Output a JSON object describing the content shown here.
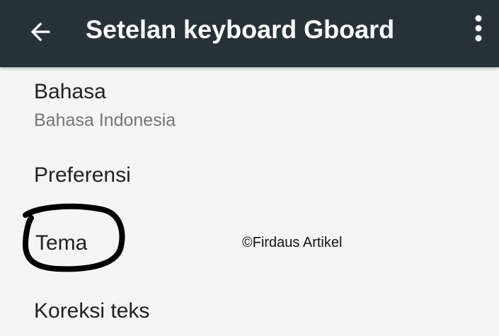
{
  "app_bar": {
    "title": "Setelan keyboard Gboard",
    "background": "#263238",
    "back_icon": "arrow-back-icon",
    "overflow_icon": "more-vert-icon"
  },
  "settings": {
    "items": [
      {
        "title": "Bahasa",
        "summary": "Bahasa Indonesia"
      },
      {
        "title": "Preferensi"
      },
      {
        "title": "Tema"
      },
      {
        "title": "Koreksi teks"
      }
    ]
  },
  "watermark": "©Firdaus Artikel",
  "annotation": {
    "shape": "hand-drawn-circle",
    "target": "Tema",
    "color": "#000000"
  }
}
